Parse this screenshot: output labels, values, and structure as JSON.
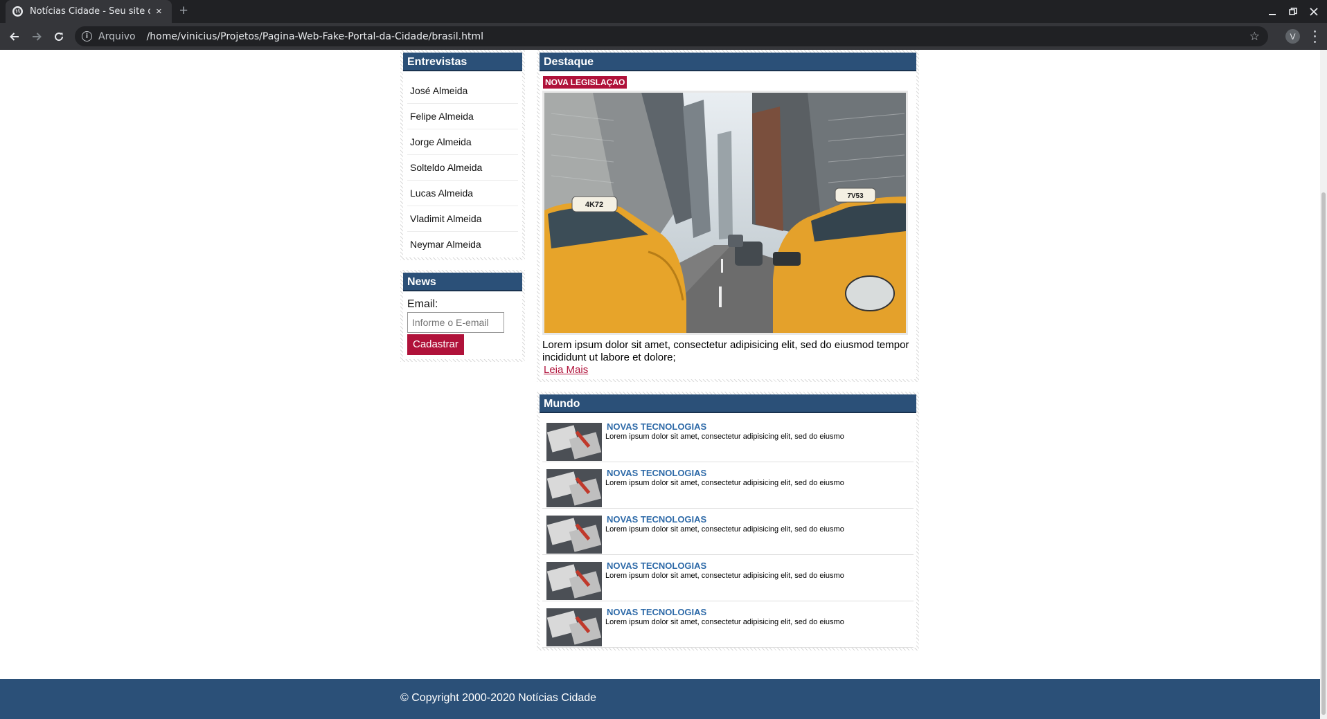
{
  "browser": {
    "tab_title": "Notícias Cidade - Seu site de notícias",
    "new_tab_symbol": "+",
    "close_symbol": "×",
    "address_prefix": "Arquivo",
    "url": "/home/vinicius/Projetos/Pagina-Web-Fake-Portal-da-Cidade/brasil.html",
    "profile_initial": "V",
    "star_symbol": "☆"
  },
  "sidebar": {
    "entrevistas_title": "Entrevistas",
    "interviews": [
      "José Almeida",
      "Felipe Almeida",
      "Jorge Almeida",
      "Solteldo Almeida",
      "Lucas Almeida",
      "Vladimit Almeida",
      "Neymar Almeida"
    ],
    "news_title": "News",
    "email_label": "Email:",
    "email_placeholder": "Informe o E-email",
    "submit_label": "Cadastrar"
  },
  "destaque": {
    "title": "Destaque",
    "tag": "NOVA LEGISLAÇAO",
    "text": "Lorem ipsum dolor sit amet, consectetur adipisicing elit, sed do eiusmod tempor incididunt ut labore et dolore;",
    "link": "Leia Mais",
    "taxi_plate_left": "4K72",
    "taxi_plate_right": "7V53"
  },
  "mundo": {
    "title": "Mundo",
    "items": [
      {
        "title": "NOVAS TECNOLOGIAS",
        "text": "Lorem ipsum dolor sit amet, consectetur adipisicing elit, sed do eiusmo"
      },
      {
        "title": "NOVAS TECNOLOGIAS",
        "text": "Lorem ipsum dolor sit amet, consectetur adipisicing elit, sed do eiusmo"
      },
      {
        "title": "NOVAS TECNOLOGIAS",
        "text": "Lorem ipsum dolor sit amet, consectetur adipisicing elit, sed do eiusmo"
      },
      {
        "title": "NOVAS TECNOLOGIAS",
        "text": "Lorem ipsum dolor sit amet, consectetur adipisicing elit, sed do eiusmo"
      },
      {
        "title": "NOVAS TECNOLOGIAS",
        "text": "Lorem ipsum dolor sit amet, consectetur adipisicing elit, sed do eiusmo"
      }
    ]
  },
  "footer": {
    "copyright": "© Copyright 2000-2020 Notícias Cidade"
  },
  "colors": {
    "header_blue": "#2b5078",
    "accent_red": "#b0123a",
    "link_blue": "#2e6aa8",
    "chrome_dark": "#202124"
  }
}
